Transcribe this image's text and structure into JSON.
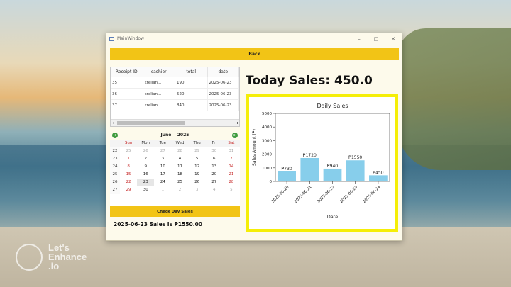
{
  "window": {
    "title": "MainWindow",
    "controls": {
      "minimize": "–",
      "maximize": "□",
      "close": "✕"
    }
  },
  "back_button": {
    "label": "Back"
  },
  "table": {
    "columns": [
      "Receipt ID",
      "cashier",
      "total",
      "date"
    ],
    "rows": [
      [
        "35",
        "krelian...",
        "190",
        "2025-06-23"
      ],
      [
        "36",
        "krelian...",
        "520",
        "2025-06-23"
      ],
      [
        "37",
        "krelian...",
        "840",
        "2025-06-23"
      ]
    ],
    "scroll_left": "◂",
    "scroll_right": "▸"
  },
  "calendar": {
    "month": "June",
    "year": "2025",
    "prev": "◂",
    "next": "▸",
    "days_of_week": [
      "Sun",
      "Mon",
      "Tue",
      "Wed",
      "Thu",
      "Fri",
      "Sat"
    ],
    "weeks": [
      {
        "week": "22",
        "days": [
          "25",
          "26",
          "27",
          "28",
          "29",
          "30",
          "31"
        ]
      },
      {
        "week": "23",
        "days": [
          "1",
          "2",
          "3",
          "4",
          "5",
          "6",
          "7"
        ]
      },
      {
        "week": "24",
        "days": [
          "8",
          "9",
          "10",
          "11",
          "12",
          "13",
          "14"
        ]
      },
      {
        "week": "25",
        "days": [
          "15",
          "16",
          "17",
          "18",
          "19",
          "20",
          "21"
        ]
      },
      {
        "week": "26",
        "days": [
          "22",
          "23",
          "24",
          "25",
          "26",
          "27",
          "28"
        ]
      },
      {
        "week": "27",
        "days": [
          "29",
          "30",
          "1",
          "2",
          "3",
          "4",
          "5"
        ]
      }
    ],
    "selected_day": "23"
  },
  "check_button": {
    "label": "Check Day Sales"
  },
  "result": {
    "text": "2025-06-23  Sales Is  ₱1550.00"
  },
  "today_sales": {
    "text": "Today Sales:  450.0"
  },
  "watermark": {
    "line1": "Let's",
    "line2": "Enhance",
    "line3": ".io"
  },
  "colors": {
    "accent": "#f2c416",
    "highlight": "#f5ee07",
    "bar": "#87ceeb"
  },
  "chart_data": {
    "type": "bar",
    "title": "Daily Sales",
    "xlabel": "Date",
    "ylabel": "Sales Amount (₱)",
    "categories": [
      "2025-06-20",
      "2025-06-21",
      "2025-06-22",
      "2025-06-23",
      "2025-06-24"
    ],
    "values": [
      730,
      1720,
      940,
      1550,
      450
    ],
    "labels": [
      "₱730",
      "₱1720",
      "₱940",
      "₱1550",
      "₱450"
    ],
    "ylim": [
      0,
      5000
    ],
    "yticks": [
      0,
      1000,
      2000,
      3000,
      4000,
      5000
    ],
    "grid": false
  }
}
